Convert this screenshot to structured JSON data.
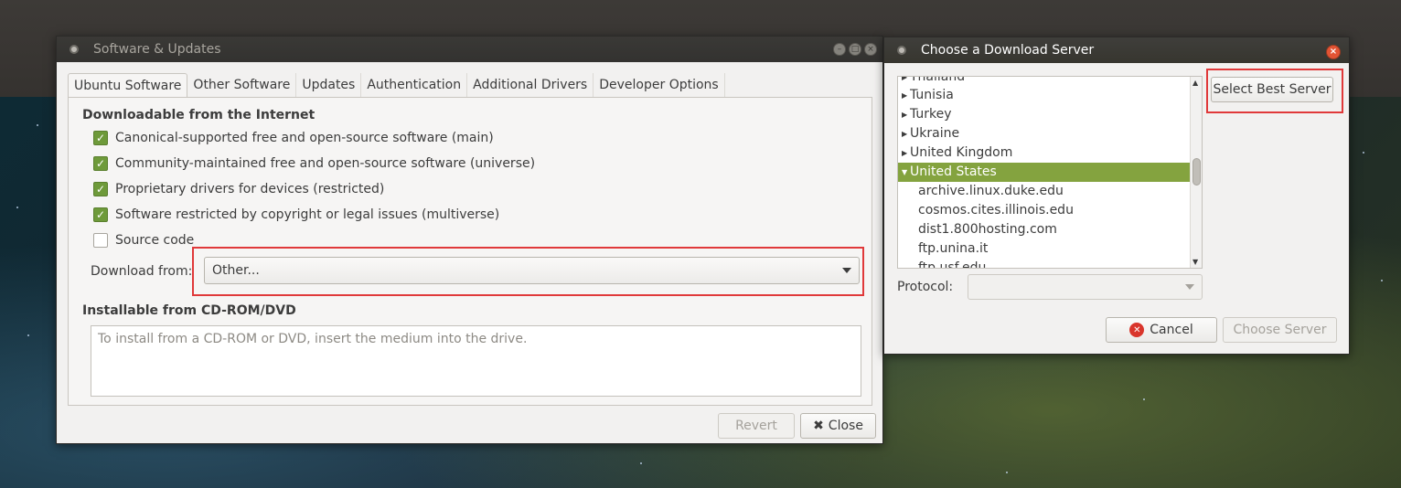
{
  "sw_window": {
    "title": "Software & Updates",
    "tabs": [
      "Ubuntu Software",
      "Other Software",
      "Updates",
      "Authentication",
      "Additional Drivers",
      "Developer Options"
    ],
    "active_tab": "Ubuntu Software",
    "downloadable_title": "Downloadable from the Internet",
    "checks": [
      {
        "label": "Canonical-supported free and open-source software (main)",
        "checked": true
      },
      {
        "label": "Community-maintained free and open-source software (universe)",
        "checked": true
      },
      {
        "label": "Proprietary drivers for devices (restricted)",
        "checked": true
      },
      {
        "label": "Software restricted by copyright or legal issues (multiverse)",
        "checked": true
      },
      {
        "label": "Source code",
        "checked": false
      }
    ],
    "download_from_label": "Download from:",
    "download_from_value": "Other...",
    "cdrom_title": "Installable from CD-ROM/DVD",
    "cdrom_text": "To install from a CD-ROM or DVD, insert the medium into the drive.",
    "revert_label": "Revert",
    "close_label": "Close"
  },
  "dl_window": {
    "title": "Choose a Download Server",
    "partial_top_item": "Thailand",
    "countries": [
      "Tunisia",
      "Turkey",
      "Ukraine",
      "United Kingdom"
    ],
    "selected_country": "United States",
    "servers": [
      "archive.linux.duke.edu",
      "cosmos.cites.illinois.edu",
      "dist1.800hosting.com",
      "ftp.unina.it"
    ],
    "partial_bottom_item": "ftp.usf.edu",
    "select_best_label": "Select Best Server",
    "protocol_label": "Protocol:",
    "protocol_value": "",
    "cancel_label": "Cancel",
    "choose_label": "Choose Server"
  },
  "colors": {
    "accent_green": "#84a33f",
    "highlight_red": "#e0393a",
    "cancel_icon_red": "#d9352b"
  }
}
